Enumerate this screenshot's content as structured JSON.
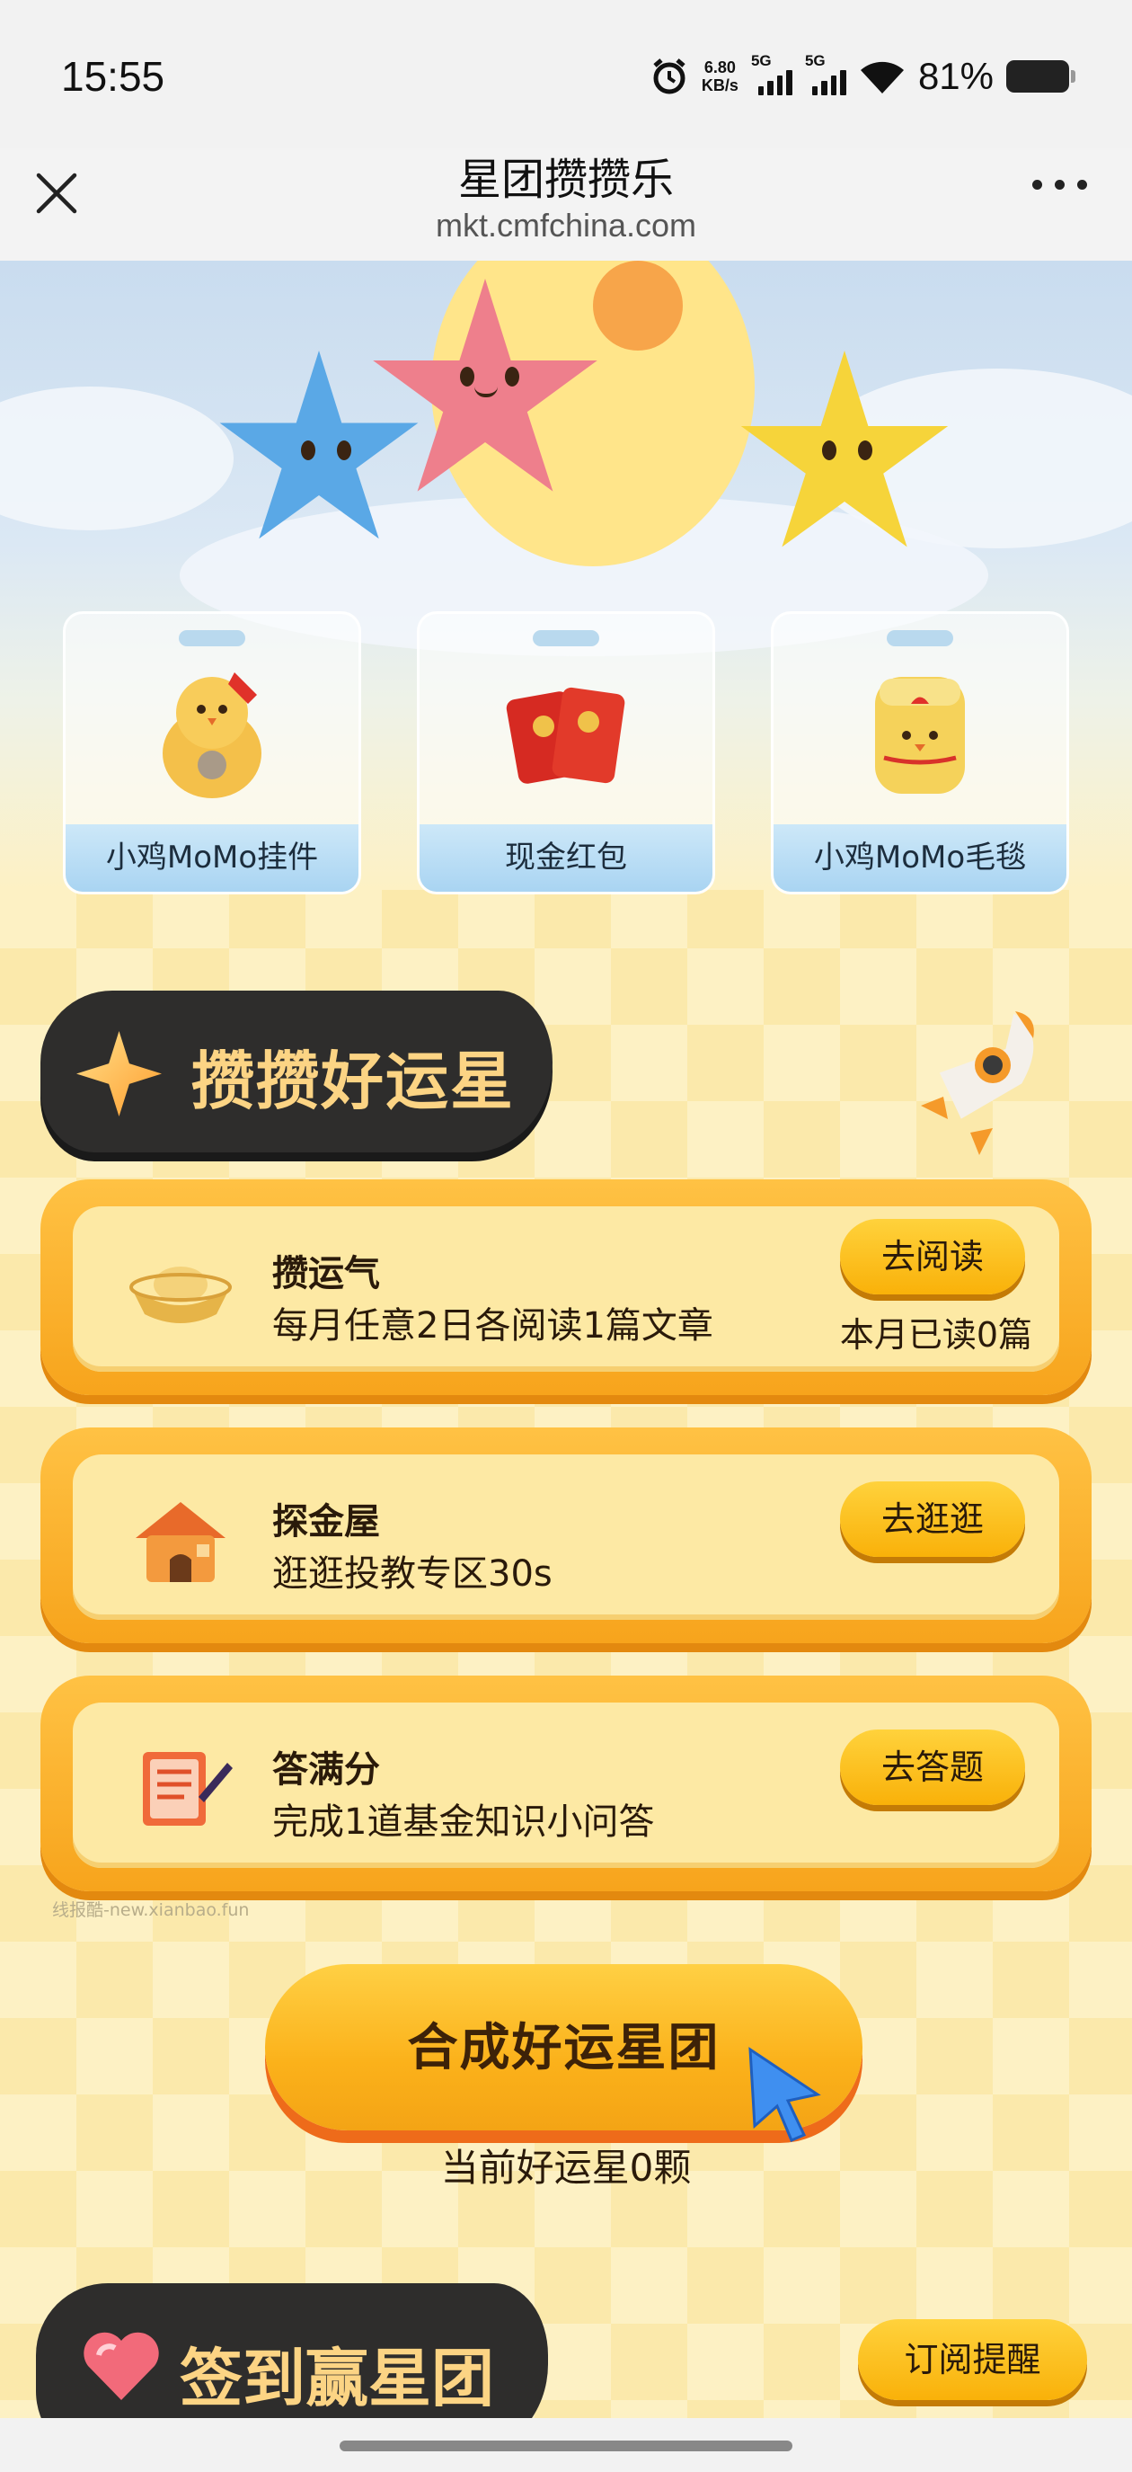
{
  "status_bar": {
    "time": "15:55",
    "speed_value": "6.80",
    "speed_unit": "KB/s",
    "signal1_label": "5G",
    "signal2_label": "5G",
    "battery_pct": "81%"
  },
  "nav": {
    "title": "星团攒攒乐",
    "url": "mkt.cmfchina.com"
  },
  "prizes": [
    {
      "label": "小鸡MoMo挂件"
    },
    {
      "label": "现金红包"
    },
    {
      "label": "小鸡MoMo毛毯"
    }
  ],
  "section1": {
    "title": "攒攒好运星"
  },
  "tasks": [
    {
      "title": "攒运气",
      "desc": "每月任意2日各阅读1篇文章",
      "button": "去阅读",
      "note": "本月已读0篇",
      "icon": "gold-ingot-icon"
    },
    {
      "title": "探金屋",
      "desc": "逛逛投教专区30s",
      "button": "去逛逛",
      "icon": "house-icon"
    },
    {
      "title": "答满分",
      "desc": "完成1道基金知识小问答",
      "button": "去答题",
      "icon": "scroll-icon"
    }
  ],
  "watermark": "线报酷-new.xianbao.fun",
  "combine": {
    "button": "合成好运星团",
    "count_text": "当前好运星0颗"
  },
  "section2": {
    "title": "签到赢星团",
    "subscribe": "订阅提醒"
  },
  "colors": {
    "accent_orange": "#f7a41c",
    "button_yellow": "#ffd23c",
    "header_dark": "#2e2d2c",
    "header_text": "#fcd484"
  }
}
